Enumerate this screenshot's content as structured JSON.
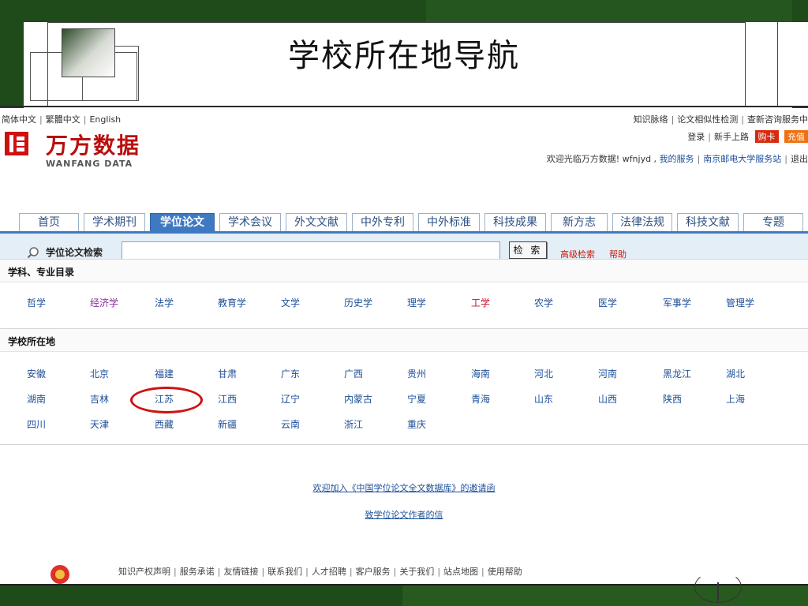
{
  "slide": {
    "title": "学校所在地导航"
  },
  "header": {
    "lang": [
      "简体中文",
      "繁體中文",
      "English"
    ],
    "logo_cn": "万方数据",
    "logo_en": "WANFANG DATA",
    "top_links": [
      "知识脉络",
      "论文相似性检测",
      "查新咨询服务中"
    ],
    "login": "登录",
    "guide": "新手上路",
    "buy_card": "购卡",
    "recharge": "充值",
    "welcome_text": "欢迎光临万方数据! wfnjyd ,",
    "my_service": "我的服务",
    "station": "南京邮电大学服务站",
    "logout": "退出"
  },
  "tabs": [
    "首页",
    "学术期刊",
    "学位论文",
    "学术会议",
    "外文文献",
    "中外专利",
    "中外标准",
    "科技成果",
    "新方志",
    "法律法规",
    "科技文献",
    "专题"
  ],
  "search": {
    "label": "学位论文检索",
    "value": "",
    "button": "检 索",
    "advanced": "高级检索",
    "help": "帮助"
  },
  "subjects": {
    "title": "学科、专业目录",
    "items": [
      "哲学",
      "经济学",
      "法学",
      "教育学",
      "文学",
      "历史学",
      "理学",
      "工学",
      "农学",
      "医学",
      "军事学",
      "管理学"
    ]
  },
  "locations": {
    "title": "学校所在地",
    "items": [
      "安徽",
      "北京",
      "福建",
      "甘肃",
      "广东",
      "广西",
      "贵州",
      "海南",
      "河北",
      "河南",
      "黑龙江",
      "湖北",
      "湖南",
      "吉林",
      "江苏",
      "江西",
      "辽宁",
      "内蒙古",
      "宁夏",
      "青海",
      "山东",
      "山西",
      "陕西",
      "上海",
      "四川",
      "天津",
      "西藏",
      "新疆",
      "云南",
      "浙江",
      "重庆"
    ]
  },
  "links": {
    "invite": "欢迎加入《中国学位论文全文数据库》的邀请函",
    "letter": "致学位论文作者的信"
  },
  "footer": [
    "知识产权声明",
    "服务承诺",
    "友情链接",
    "联系我们",
    "人才招聘",
    "客户服务",
    "关于我们",
    "站点地图",
    "使用帮助"
  ]
}
